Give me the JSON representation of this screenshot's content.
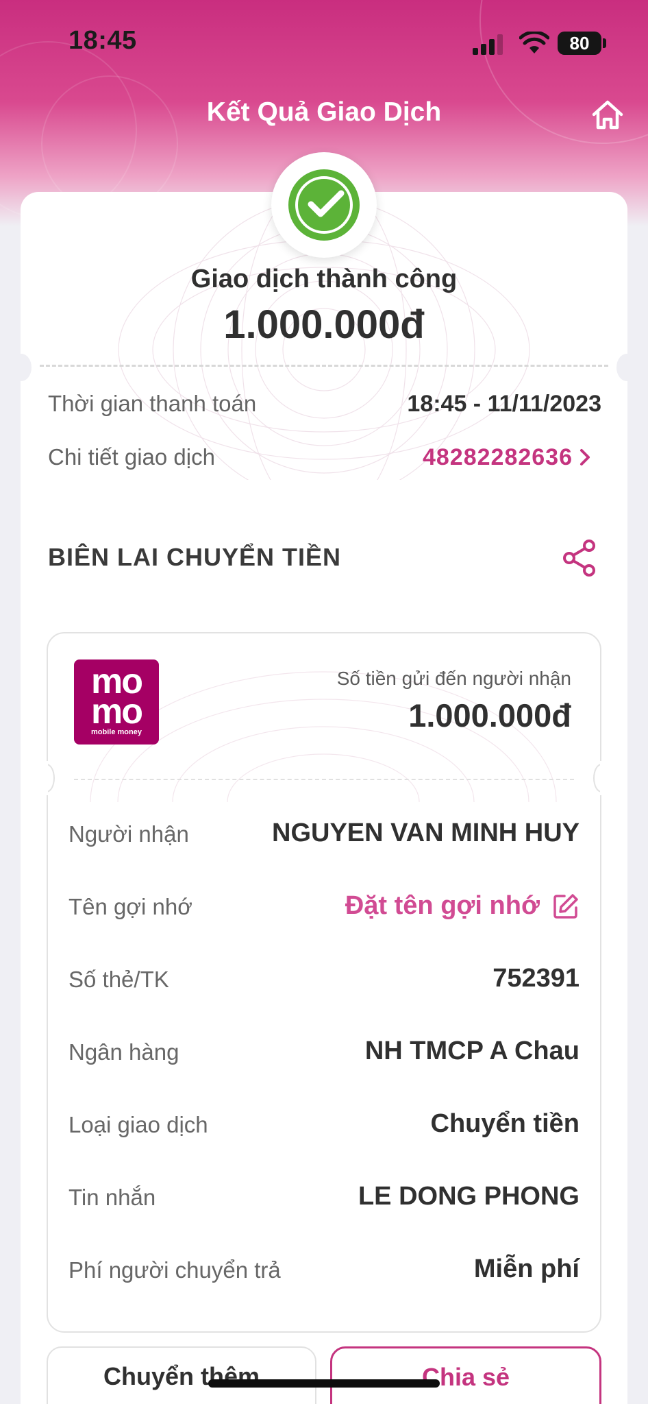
{
  "status_bar": {
    "time": "18:45",
    "battery": "80"
  },
  "header": {
    "title": "Kết Quả Giao Dịch",
    "home_icon": "home-icon"
  },
  "result": {
    "status": "Giao dịch thành công",
    "amount": "1.000.000đ",
    "payment_time_label": "Thời gian thanh toán",
    "payment_time_value": "18:45 - 11/11/2023",
    "detail_label": "Chi tiết giao dịch",
    "detail_value": "48282282636"
  },
  "receipt": {
    "section_title": "BIÊN LAI CHUYỂN TIỀN",
    "logo": {
      "line1": "mo",
      "line2": "mo",
      "tagline": "mobile money"
    },
    "recv_label": "Số tiền gửi đến người nhận",
    "recv_amount": "1.000.000đ",
    "rows": [
      {
        "label": "Người nhận",
        "value": "NGUYEN VAN MINH HUY"
      },
      {
        "label": "Tên gợi nhớ",
        "value": "Đặt tên gợi nhớ"
      },
      {
        "label": "Số thẻ/TK",
        "value": "752391"
      },
      {
        "label": "Ngân hàng",
        "value": "NH TMCP A Chau"
      },
      {
        "label": "Loại giao dịch",
        "value": "Chuyển tiền"
      },
      {
        "label": "Tin nhắn",
        "value": "LE DONG PHONG"
      },
      {
        "label": "Phí người chuyển trả",
        "value": "Miễn phí"
      }
    ]
  },
  "actions": {
    "more": "Chuyển thêm",
    "share": "Chia sẻ"
  },
  "colors": {
    "brand_pink": "#c4347f",
    "momo": "#a50064",
    "success_green": "#5cb338"
  }
}
